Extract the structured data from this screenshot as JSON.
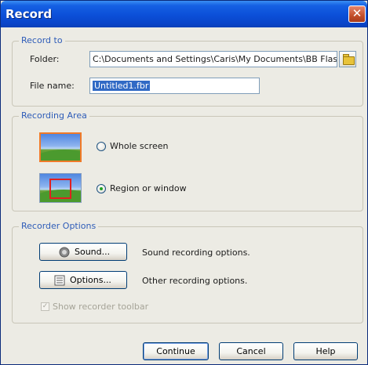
{
  "window": {
    "title": "Record"
  },
  "record_to": {
    "legend": "Record to",
    "folder_label": "Folder:",
    "folder_value": "C:\\Documents and Settings\\Caris\\My Documents\\BB Flash",
    "file_label": "File name:",
    "file_value": "Untitled1.fbr"
  },
  "recording_area": {
    "legend": "Recording Area",
    "whole_screen": "Whole screen",
    "region": "Region or window",
    "selected": "region"
  },
  "recorder_options": {
    "legend": "Recorder Options",
    "sound_button": "Sound...",
    "sound_desc": "Sound recording options.",
    "options_button": "Options...",
    "options_desc": "Other recording options.",
    "toolbar_checkbox": "Show recorder toolbar",
    "toolbar_checked": true
  },
  "footer": {
    "continue": "Continue",
    "cancel": "Cancel",
    "help": "Help"
  },
  "colors": {
    "titlebar": "#0b4fd8",
    "legend": "#2e5cb8",
    "selection": "#316ac5",
    "close": "#c3502b"
  },
  "icons": {
    "close": "close-icon",
    "folder": "folder-icon",
    "sound": "speaker-icon",
    "options": "options-list-icon"
  }
}
